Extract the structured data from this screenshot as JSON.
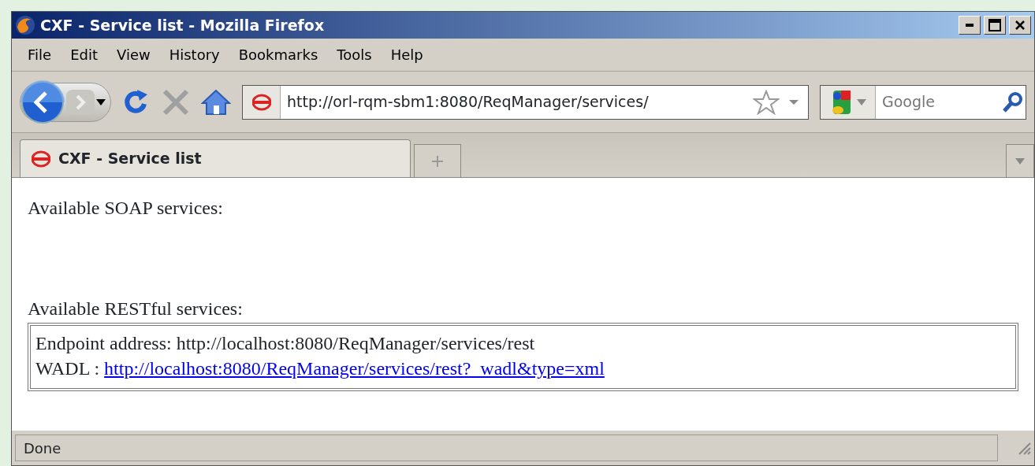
{
  "window": {
    "title": "CXF - Service list - Mozilla Firefox"
  },
  "menu": [
    "File",
    "Edit",
    "View",
    "History",
    "Bookmarks",
    "Tools",
    "Help"
  ],
  "address_bar": {
    "value": "http://orl-rqm-sbm1:8080/ReqManager/services/"
  },
  "search": {
    "placeholder": "Google"
  },
  "tabs": [
    {
      "label": "CXF - Service list",
      "selected": true
    }
  ],
  "page": {
    "soap_heading": "Available SOAP services:",
    "rest_heading": "Available RESTful services:",
    "rest_services": [
      {
        "endpoint": "Endpoint address: http://localhost:8080/ReqManager/services/rest",
        "wadl_label": "WADL :",
        "wadl_link": "http://localhost:8080/ReqManager/services/rest?_wadl&type=xml"
      }
    ]
  },
  "status_bar": "Done"
}
